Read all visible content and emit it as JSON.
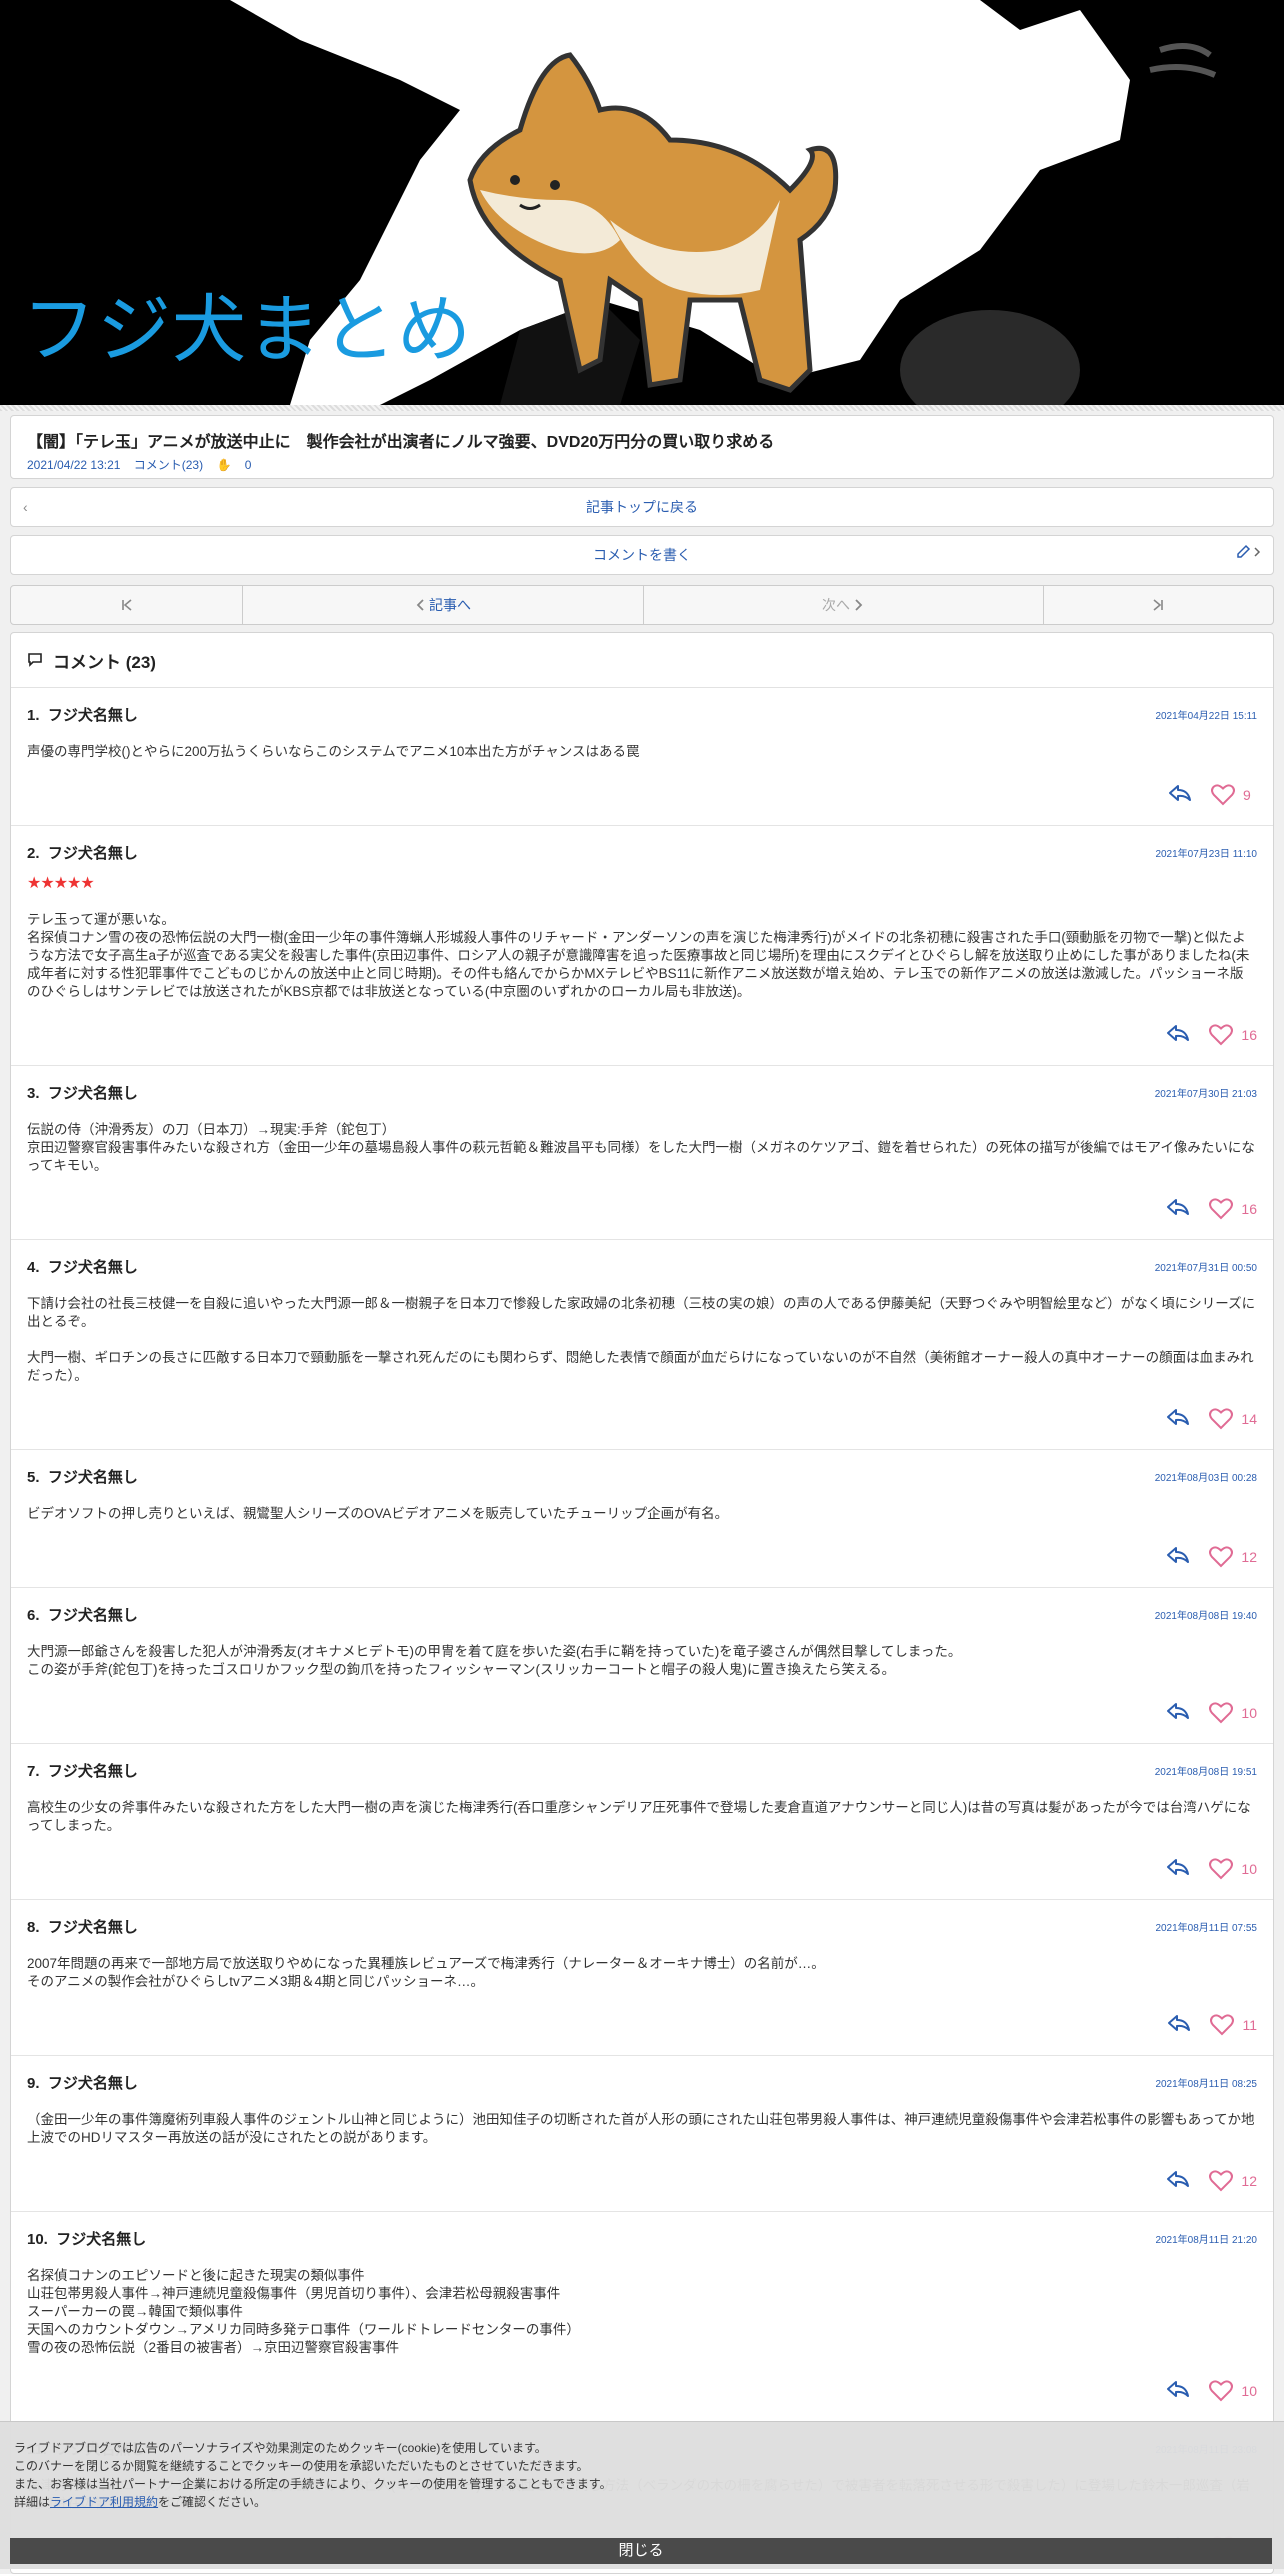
{
  "site": {
    "title": "フジ犬まとめ"
  },
  "article": {
    "title": "【闇】「テレ玉」アニメが放送中止に　製作会社が出演者にノルマ強要、DVD20万円分の買い取り求める",
    "date": "2021/04/22 13:21",
    "comments_link": "コメント(23)",
    "clap_count": "0"
  },
  "nav": {
    "back_to_top": "記事トップに戻る",
    "write_comment": "コメントを書く",
    "prev_label": "記事へ",
    "next_label": "次へ"
  },
  "comment_section": {
    "title": "コメント (23)"
  },
  "comments": [
    {
      "num": "1.",
      "name": "フジ犬名無し",
      "date": "2021年04月22日 15:11",
      "stars": "",
      "body": "声優の専門学校()とやらに200万払うくらいならこのシステムでアニメ10本出た方がチャンスはある罠",
      "likes": "9"
    },
    {
      "num": "2.",
      "name": "フジ犬名無し",
      "date": "2021年07月23日 11:10",
      "stars": "★★★★★",
      "body": "テレ玉って運が悪いな。\n名探偵コナン雪の夜の恐怖伝説の大門一樹(金田一少年の事件簿蝋人形城殺人事件のリチャード・アンダーソンの声を演じた梅津秀行)がメイドの北条初穂に殺害された手口(頸動脈を刃物で一撃)と似たような方法で女子高生a子が巡査である実父を殺害した事件(京田辺事件、ロシア人の親子が意識障害を追った医療事故と同じ場所)を理由にスクデイとひぐらし解を放送取り止めにした事がありましたね(未成年者に対する性犯罪事件でこどものじかんの放送中止と同じ時期)。その件も絡んでからかMXテレビやBS11に新作アニメ放送数が増え始め、テレ玉での新作アニメの放送は激減した。パッショーネ版のひぐらしはサンテレビでは放送されたがKBS京都では非放送となっている(中京圏のいずれかのローカル局も非放送)。",
      "likes": "16"
    },
    {
      "num": "3.",
      "name": "フジ犬名無し",
      "date": "2021年07月30日 21:03",
      "stars": "",
      "body": "伝説の侍（沖滑秀友）の刀（日本刀）→現実:手斧（鉈包丁）\n京田辺警察官殺害事件みたいな殺され方（金田一少年の墓場島殺人事件の萩元哲範＆難波昌平も同様）をした大門一樹（メガネのケツアゴ、鎧を着せられた）の死体の描写が後編ではモアイ像みたいになってキモい。",
      "likes": "16"
    },
    {
      "num": "4.",
      "name": "フジ犬名無し",
      "date": "2021年07月31日 00:50",
      "stars": "",
      "body": "下請け会社の社長三枝健一を自殺に追いやった大門源一郎＆一樹親子を日本刀で惨殺した家政婦の北条初穂（三枝の実の娘）の声の人である伊藤美紀（天野つぐみや明智絵里など）がなく頃にシリーズに出とるぞ。\n\n大門一樹、ギロチンの長さに匹敵する日本刀で頸動脈を一撃され死んだのにも関わらず、悶絶した表情で顔面が血だらけになっていないのが不自然（美術館オーナー殺人の真中オーナーの顔面は血まみれだった）。",
      "likes": "14"
    },
    {
      "num": "5.",
      "name": "フジ犬名無し",
      "date": "2021年08月03日 00:28",
      "stars": "",
      "body": "ビデオソフトの押し売りといえば、親鸞聖人シリーズのOVAビデオアニメを販売していたチューリップ企画が有名。",
      "likes": "12"
    },
    {
      "num": "6.",
      "name": "フジ犬名無し",
      "date": "2021年08月08日 19:40",
      "stars": "",
      "body": "大門源一郎爺さんを殺害した犯人が沖滑秀友(オキナメヒデトモ)の甲冑を着て庭を歩いた姿(右手に鞘を持っていた)を竜子婆さんが偶然目撃してしまった。\nこの姿が手斧(鉈包丁)を持ったゴスロリかフック型の鉤爪を持ったフィッシャーマン(スリッカーコートと帽子の殺人鬼)に置き換えたら笑える。",
      "likes": "10"
    },
    {
      "num": "7.",
      "name": "フジ犬名無し",
      "date": "2021年08月08日 19:51",
      "stars": "",
      "body": "高校生の少女の斧事件みたいな殺された方をした大門一樹の声を演じた梅津秀行(呑口重彦シャンデリア圧死事件で登場した麦倉直道アナウンサーと同じ人)は昔の写真は髪があったが今では台湾ハゲになってしまった。",
      "likes": "10"
    },
    {
      "num": "8.",
      "name": "フジ犬名無し",
      "date": "2021年08月11日 07:55",
      "stars": "",
      "body": "2007年問題の再来で一部地方局で放送取りやめになった異種族レビュアーズで梅津秀行（ナレーター＆オーキナ博士）の名前が…。\nそのアニメの製作会社がひぐらしtvアニメ3期＆4期と同じパッショーネ…。",
      "likes": "11"
    },
    {
      "num": "9.",
      "name": "フジ犬名無し",
      "date": "2021年08月11日 08:25",
      "stars": "",
      "body": "（金田一少年の事件簿魔術列車殺人事件のジェントル山神と同じように）池田知佳子の切断された首が人形の頭にされた山荘包帯男殺人事件は、神戸連続児童殺傷事件や会津若松事件の影響もあってか地上波でのHDリマスター再放送の話が没にされたとの説があります。",
      "likes": "12"
    },
    {
      "num": "10.",
      "name": "フジ犬名無し",
      "date": "2021年08月11日 21:20",
      "stars": "",
      "body": "名探偵コナンのエピソードと後に起きた現実の類似事件\n山荘包帯男殺人事件→神戸連続児童殺傷事件（男児首切り事件）、会津若松母親殺害事件\nスーパーカーの罠→韓国で類似事件\n天国へのカウントダウン→アメリカ同時多発テロ事件（ワールドトレードセンターの事件）\n雪の夜の恐怖伝説（2番目の被害者）→京田辺警察官殺害事件",
      "likes": "10"
    },
    {
      "num": "11.",
      "name": "フジ犬名無し",
      "date": "2021年08月11日 23:08",
      "stars": "",
      "body": "梅津秀行ってハニーカクテル殺人事件（後の話である末亡人(ミズロンリー)と探偵団とほぼ同じ方法（ベランダの木の柵を腐らせた）で被害者を転落死させる形で殺害した）に登場した鈴木一郎巡査（岩見町駐在の警察官）の声の人だった。",
      "likes": ""
    }
  ],
  "cookie": {
    "line1": "ライブドアブログでは広告のパーソナライズや効果測定のためクッキー(cookie)を使用しています。",
    "line2": "このバナーを閉じるか閲覧を継続することでクッキーの使用を承認いただいたものとさせていただきます。",
    "line3": "また、お客様は当社パートナー企業における所定の手続きにより、クッキーの使用を管理することもできます。",
    "line4_prefix": "詳細は",
    "line4_link": "ライブドア利用規約",
    "line4_suffix": "をご確認ください。",
    "close": "閉じる"
  },
  "colors": {
    "accent": "#2a5db0",
    "title_blue": "#1a9be0",
    "like_pink": "#e06b94",
    "star_red": "#ee3333"
  },
  "icons": [
    "back-chevron-icon",
    "pencil-icon",
    "first-page-icon",
    "chevron-left-icon",
    "chevron-right-icon",
    "last-page-icon",
    "comment-bubble-icon",
    "reply-icon",
    "heart-icon",
    "clap-icon"
  ]
}
